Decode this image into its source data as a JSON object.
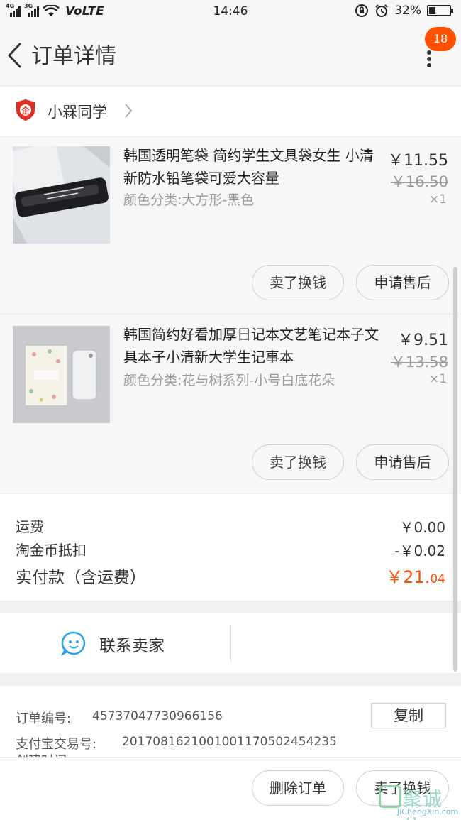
{
  "status_bar": {
    "signal1": "4G",
    "signal2": "3G",
    "network": "VoLTE",
    "time": "14:46",
    "battery_text": "32%",
    "battery_level": 0.32
  },
  "header": {
    "title": "订单详情",
    "notification_count": "18",
    "badge_color": "#ff5000"
  },
  "shop": {
    "name": "小槑同学",
    "icon": "shop-badge-icon"
  },
  "items": [
    {
      "title": "韩国透明笔袋 简约学生文具袋女生 小清新防水铅笔袋可爱大容量",
      "spec": "颜色分类:大方形-黑色",
      "price": "￥11.55",
      "original_price": "￥16.50",
      "quantity": "×1",
      "actions": [
        "卖了换钱",
        "申请售后"
      ]
    },
    {
      "title": "韩国简约好看加厚日记本文艺笔记本子文具本子小清新大学生记事本",
      "spec": "颜色分类:花与树系列-小号白底花朵",
      "price": "￥9.51",
      "original_price": "￥13.58",
      "quantity": "×1",
      "actions": [
        "卖了换钱",
        "申请售后"
      ]
    }
  ],
  "summary": {
    "shipping_label": "运费",
    "shipping_value": "￥0.00",
    "coin_label": "淘金币抵扣",
    "coin_value": "-￥0.02",
    "total_label": "实付款（含运费）",
    "total_main": "￥21.",
    "total_decimal": "04",
    "accent_color": "#ff5000"
  },
  "contact": {
    "label": "联系卖家",
    "icon": "chat-bubble-icon"
  },
  "order_info": {
    "order_no_label": "订单编号:",
    "order_no": "45737047730966156",
    "alipay_label": "支付宝交易号:",
    "alipay_no": "2017081621001001170502454235",
    "created_label": "创建时间",
    "copy_label": "复制"
  },
  "bottom_bar": {
    "delete_label": "删除订单",
    "sell_label": "卖了换钱"
  },
  "watermark": {
    "cn": "聚诚信",
    "en": "JiChengXin.com"
  }
}
